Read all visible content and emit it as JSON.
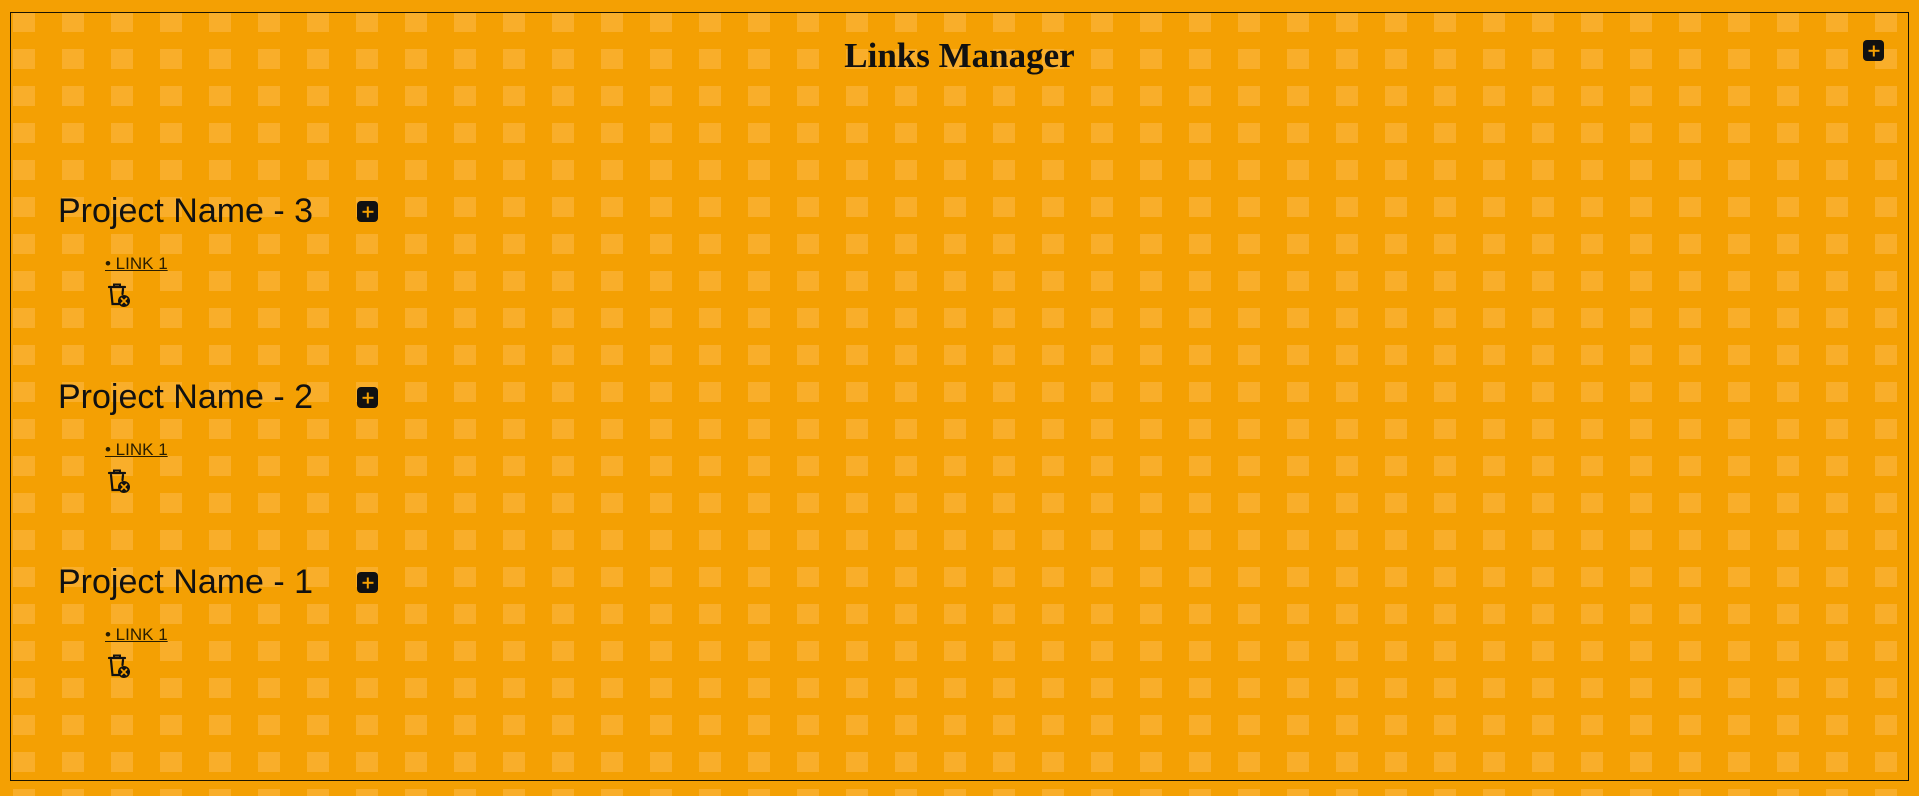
{
  "app": {
    "title": "Links Manager"
  },
  "projects": [
    {
      "name": "Project Name - 3",
      "links": [
        "• LINK 1"
      ]
    },
    {
      "name": "Project Name - 2",
      "links": [
        "• LINK 1"
      ]
    },
    {
      "name": "Project Name - 1",
      "links": [
        "• LINK 1"
      ]
    }
  ],
  "colors": {
    "background": "#f4a003",
    "tile": "#fbb744",
    "foreground": "#111111"
  },
  "icons": {
    "add": "plus-square-icon",
    "delete": "trash-x-icon"
  }
}
